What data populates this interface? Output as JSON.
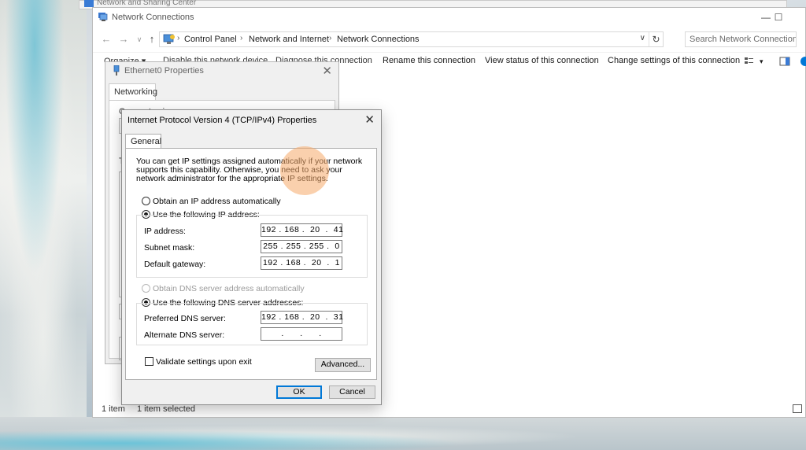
{
  "background_window": {
    "title": "Network and Sharing Center"
  },
  "explorer": {
    "title": "Network Connections",
    "window_buttons": {
      "minimize": "—",
      "maximize": "☐"
    },
    "nav": {
      "back": "←",
      "forward": "→",
      "recent": "∨",
      "up": "↑"
    },
    "breadcrumbs": [
      "Control Panel",
      "Network and Internet",
      "Network Connections"
    ],
    "breadcrumb_separator": "›",
    "address_dropdown": "∨",
    "refresh": "↻",
    "search_placeholder": "Search Network Connections",
    "commands": {
      "organize": "Organize ▾",
      "disable": "Disable this network device",
      "diagnose": "Diagnose this connection",
      "rename": "Rename this connection",
      "view_status": "View status of this connection",
      "change_settings": "Change settings of this connection",
      "view_dropdown": "▾"
    },
    "status": {
      "count": "1 item",
      "selected": "1 item selected"
    }
  },
  "ethernet_dialog": {
    "title": "Ethernet0 Properties",
    "close": "✕",
    "tab": "Networking",
    "connect_using_label": "Connect using:",
    "this_connection_label": "T"
  },
  "ipv4_dialog": {
    "title": "Internet Protocol Version 4 (TCP/IPv4) Properties",
    "close": "✕",
    "tab": "General",
    "description": "You can get IP settings assigned automatically if your network supports this capability. Otherwise, you need to ask your network administrator for the appropriate IP settings.",
    "ip_mode": {
      "auto_label": "Obtain an IP address automatically",
      "manual_label": "Use the following IP address:",
      "selected": "manual"
    },
    "ip_fields": [
      {
        "label": "IP address:",
        "value": "192 . 168 .  20  .  41"
      },
      {
        "label": "Subnet mask:",
        "value": "255 . 255 . 255 .  0"
      },
      {
        "label": "Default gateway:",
        "value": "192 . 168 .  20  .  1"
      }
    ],
    "dns_mode": {
      "auto_label": "Obtain DNS server address automatically",
      "manual_label": "Use the following DNS server addresses:",
      "selected": "manual"
    },
    "dns_fields": [
      {
        "label": "Preferred DNS server:",
        "value": "192 . 168 .  20  .  31"
      },
      {
        "label": "Alternate DNS server:",
        "value": "  .      .      .  "
      }
    ],
    "validate_label": "Validate settings upon exit",
    "validate_checked": false,
    "advanced_button": "Advanced...",
    "ok_button": "OK",
    "cancel_button": "Cancel"
  },
  "colors": {
    "accent": "#0078d7",
    "highlight": "#f6aa69"
  }
}
